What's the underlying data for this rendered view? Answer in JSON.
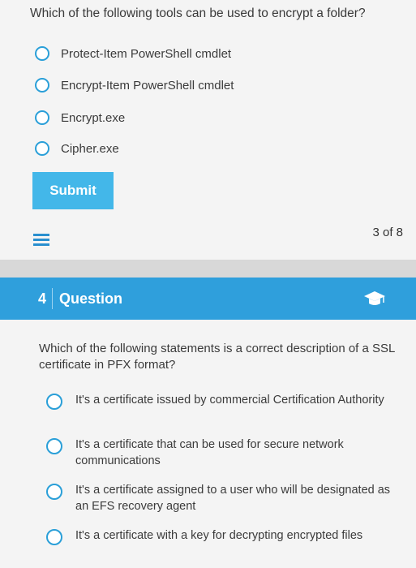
{
  "question1": {
    "text": "Which of the following tools can be used to encrypt a folder?",
    "options": [
      {
        "label": "Protect-Item PowerShell cmdlet"
      },
      {
        "label": "Encrypt-Item PowerShell cmdlet"
      },
      {
        "label": "Encrypt.exe"
      },
      {
        "label": "Cipher.exe"
      }
    ],
    "submit_label": "Submit",
    "page_count": "3 of 8"
  },
  "question2": {
    "number": "4",
    "header_title": "Question",
    "text": "Which of the following statements is a correct description of a SSL certificate in PFX format?",
    "options": [
      {
        "label": "It's a certificate issued by commercial Certification Authority"
      },
      {
        "label": "It's a certificate that can be used for secure network communications"
      },
      {
        "label": "It's a certificate assigned to a user who will be designated as an EFS recovery agent"
      },
      {
        "label": "It's a certificate with a key for decrypting encrypted files"
      }
    ]
  },
  "icons": {
    "list": "list-icon",
    "cap": "graduation-cap-icon"
  },
  "colors": {
    "accent": "#2f9fdc",
    "submit_bg": "#43b7e9",
    "radio_border": "#2a9fd8"
  }
}
